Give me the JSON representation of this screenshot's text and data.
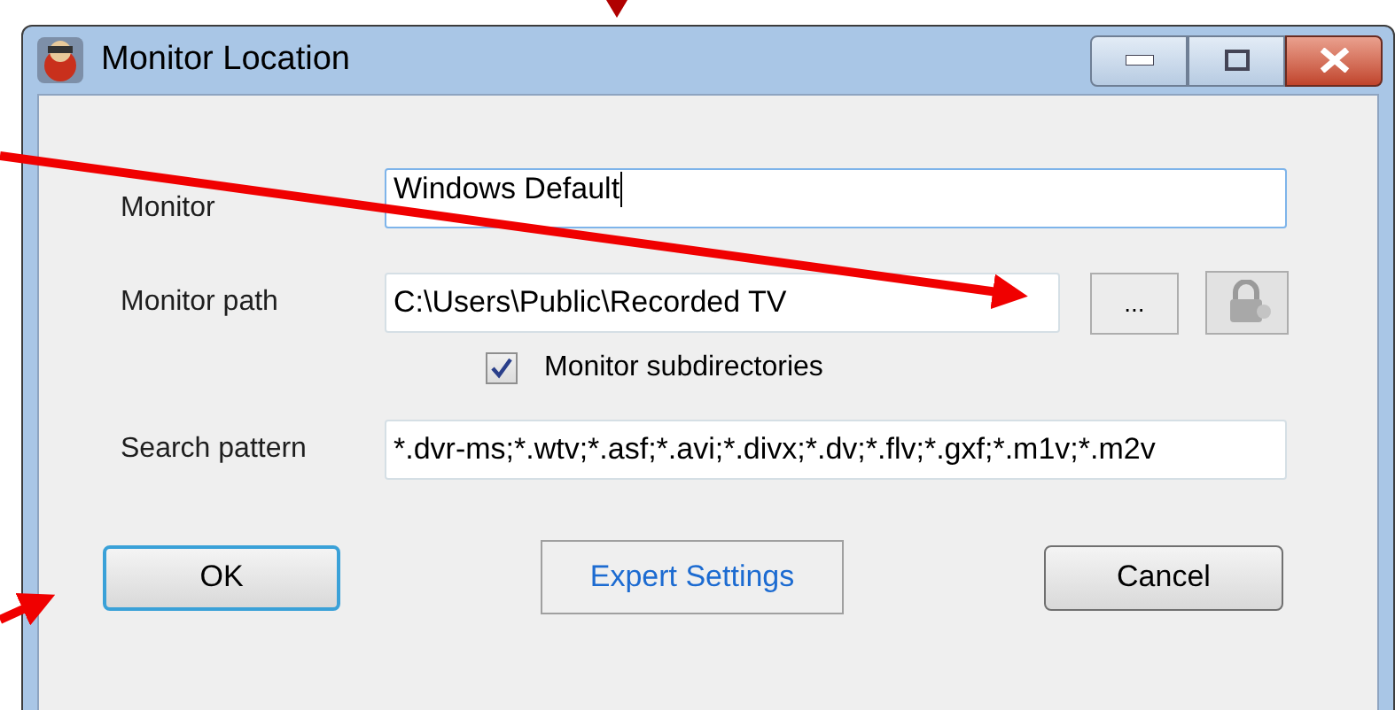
{
  "window": {
    "title": "Monitor Location"
  },
  "fields": [
    {
      "label": "Monitor",
      "value": "Windows Default",
      "focused": true
    },
    {
      "label": "Monitor path",
      "value": "C:\\Users\\Public\\Recorded TV",
      "focused": false
    },
    {
      "label": "Search pattern",
      "value": "*.dvr-ms;*.wtv;*.asf;*.avi;*.divx;*.dv;*.flv;*.gxf;*.m1v;*.m2v",
      "focused": false
    }
  ],
  "browse_button": "...",
  "checkbox": {
    "label": "Monitor subdirectories",
    "checked": true
  },
  "buttons": [
    {
      "label": "OK",
      "kind": "default"
    },
    {
      "label": "Expert Settings",
      "kind": "flat"
    },
    {
      "label": "Cancel",
      "kind": "normal"
    }
  ]
}
